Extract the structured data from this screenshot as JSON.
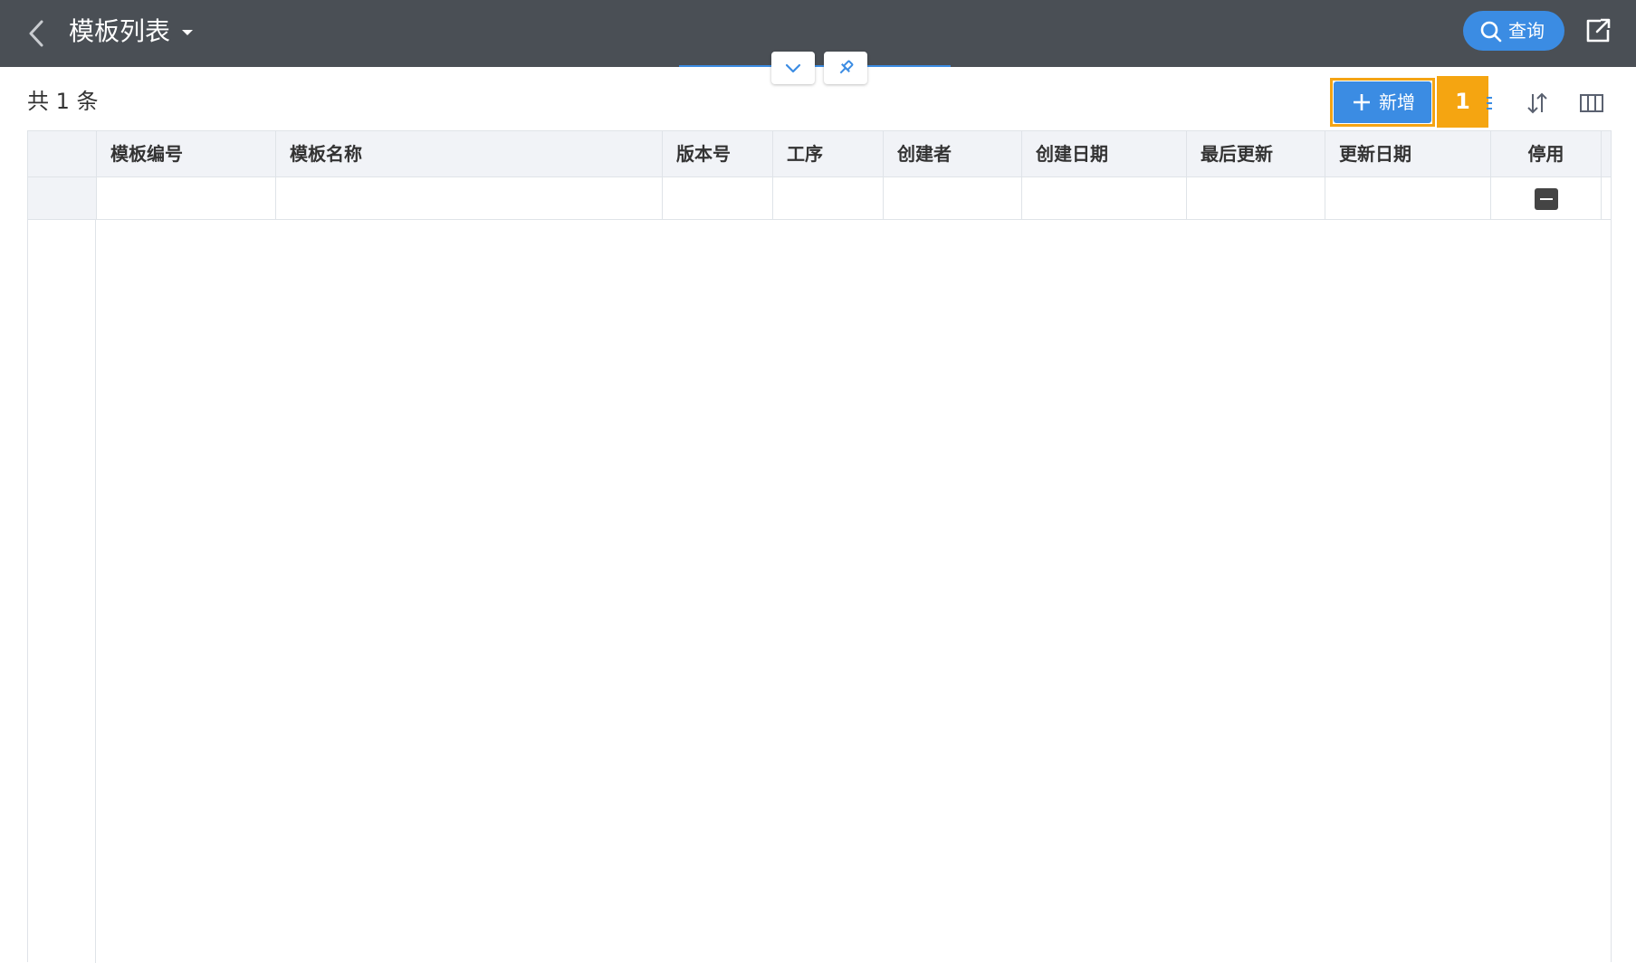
{
  "header": {
    "title": "模板列表",
    "search_label": "查询"
  },
  "toolbar": {
    "count_label": "共 1 条",
    "add_label": "新增",
    "step_badge": "1"
  },
  "table": {
    "columns": [
      "模板编号",
      "模板名称",
      "版本号",
      "工序",
      "创建者",
      "创建日期",
      "最后更新",
      "更新日期",
      "停用"
    ],
    "rows": [
      {
        "模板编号": "",
        "模板名称": "",
        "版本号": "",
        "工序": "",
        "创建者": "",
        "创建日期": "",
        "最后更新": "",
        "更新日期": "",
        "停用": "indeterminate"
      }
    ]
  },
  "colors": {
    "header_bg": "#4a4f55",
    "accent": "#3b8ce3",
    "highlight": "#f5a511",
    "table_header_bg": "#f1f3f7"
  },
  "icons": [
    "chevron-left-icon",
    "caret-down-icon",
    "search-icon",
    "share-icon",
    "chevron-down-icon",
    "pin-icon",
    "plus-icon",
    "filter-icon",
    "sort-icon",
    "columns-icon"
  ]
}
